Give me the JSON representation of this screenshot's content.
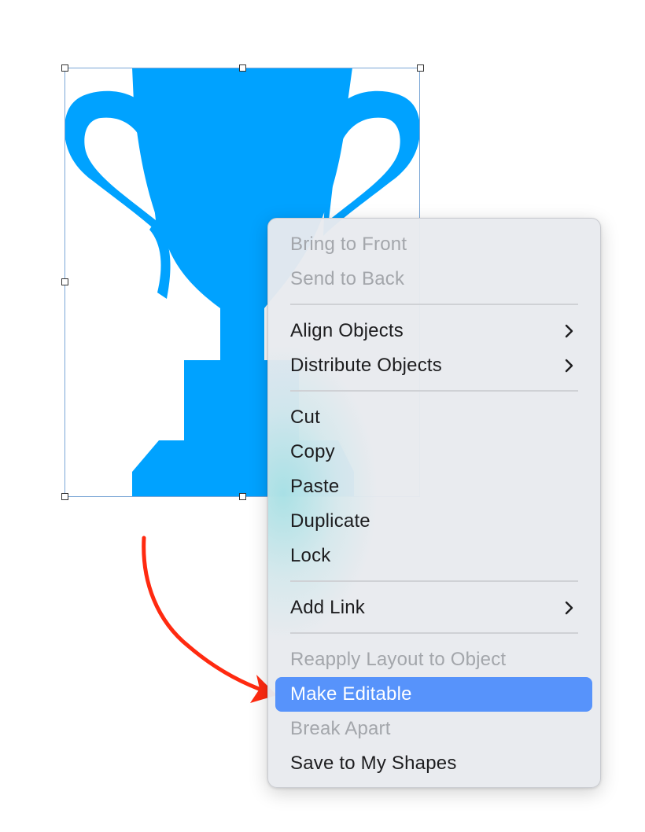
{
  "menu": {
    "items": [
      {
        "label": "Bring to Front",
        "enabled": false
      },
      {
        "label": "Send to Back",
        "enabled": false
      },
      {
        "label": "Align Objects",
        "enabled": true,
        "submenu": true
      },
      {
        "label": "Distribute Objects",
        "enabled": true,
        "submenu": true
      },
      {
        "label": "Cut",
        "enabled": true
      },
      {
        "label": "Copy",
        "enabled": true
      },
      {
        "label": "Paste",
        "enabled": true
      },
      {
        "label": "Duplicate",
        "enabled": true
      },
      {
        "label": "Lock",
        "enabled": true
      },
      {
        "label": "Add Link",
        "enabled": true,
        "submenu": true
      },
      {
        "label": "Reapply Layout to Object",
        "enabled": false
      },
      {
        "label": "Make Editable",
        "enabled": true,
        "highlighted": true
      },
      {
        "label": "Break Apart",
        "enabled": false
      },
      {
        "label": "Save to My Shapes",
        "enabled": true
      }
    ]
  },
  "colors": {
    "trophy": "#00a2ff",
    "highlight": "#5793fb",
    "annotation_arrow": "#ff2a10",
    "disabled_text": "#a3a6ab"
  },
  "icons": {
    "selected_shape": "trophy-icon",
    "submenu_indicator": "chevron-right-icon",
    "annotation": "arrow-annotation"
  }
}
